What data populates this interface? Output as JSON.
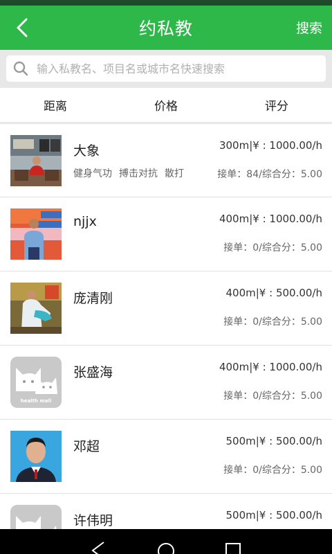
{
  "header": {
    "title": "约私教",
    "search_label": "搜索"
  },
  "search": {
    "placeholder": "输入私教名、项目名或城市名快速搜索",
    "value": ""
  },
  "sort": {
    "items": [
      {
        "label": "距离"
      },
      {
        "label": "价格"
      },
      {
        "label": "评分"
      }
    ]
  },
  "trainers": [
    {
      "name": "大象",
      "price": "300m|¥ : 1000.00/h",
      "tags": [
        "健身气功",
        "搏击对抗",
        "散打"
      ],
      "stats": "接单：84/综合分：5.00",
      "avatar": "photo-man-red-shirt"
    },
    {
      "name": "njjx",
      "price": "400m|¥ : 1000.00/h",
      "tags": [],
      "stats": "接单：0/综合分：5.00",
      "avatar": "photo-man-blue-shirt"
    },
    {
      "name": "庞清刚",
      "price": "400m|¥ : 500.00/h",
      "tags": [],
      "stats": "接单：0/综合分：5.00",
      "avatar": "photo-man-white-robe"
    },
    {
      "name": "张盛海",
      "price": "400m|¥ : 1000.00/h",
      "tags": [],
      "stats": "接单：0/综合分：5.00",
      "avatar": "default-cat-avatar"
    },
    {
      "name": "邓超",
      "price": "500m|¥ : 500.00/h",
      "tags": [],
      "stats": "接单：0/综合分：5.00",
      "avatar": "photo-man-id-portrait"
    },
    {
      "name": "许伟明",
      "price": "500m|¥ : 500.00/h",
      "tags": [],
      "stats": "",
      "avatar": "default-cat-avatar"
    }
  ],
  "default_avatar_text": "health mall",
  "colors": {
    "primary": "#2fb84a",
    "status_bar": "#1f4a2a",
    "nav_bar": "#000000"
  },
  "nav": {
    "icons": [
      "back-triangle-icon",
      "home-circle-icon",
      "recents-square-icon"
    ]
  }
}
